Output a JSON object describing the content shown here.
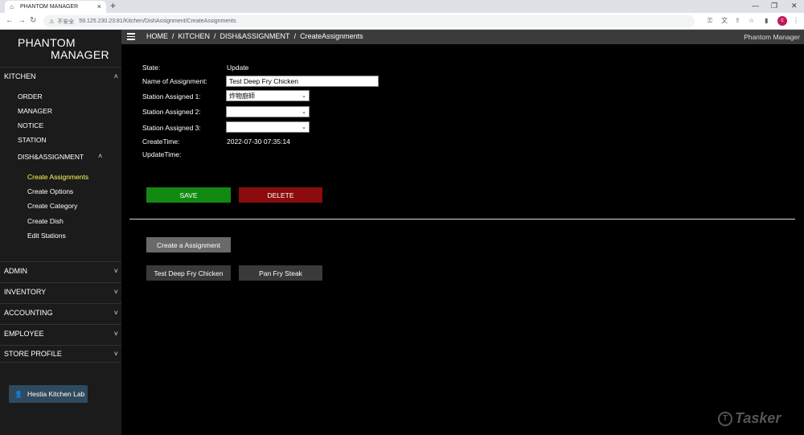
{
  "browser": {
    "tab_title": "PHANTOM MANAGER",
    "insecure_label": "不安全",
    "url": "59.125.230.23:81/Kitchen/DishAssignment/CreateAssignments",
    "profile_initial": "c"
  },
  "sidebar": {
    "brand_line1": "PHANTOM",
    "brand_line2": "MANAGER",
    "kitchen": {
      "label": "KITCHEN",
      "items": [
        "ORDER",
        "MANAGER",
        "NOTICE",
        "STATION"
      ],
      "dish_label": "DISH&ASSIGNMENT",
      "sub_items": [
        "Create Assignments",
        "Create Options",
        "Create Category",
        "Create Dish",
        "Edit Stations"
      ]
    },
    "sections": [
      "ADMIN",
      "INVENTORY",
      "ACCOUNTING",
      "EMPLOYEE",
      "STORE PROFILE"
    ],
    "user_label": "Hestia Kitchen Lab"
  },
  "header": {
    "breadcrumbs": [
      "HOME",
      "KITCHEN",
      "DISH&ASSIGNMENT",
      "CreateAssignments"
    ],
    "separator": "/",
    "app_name": "Phantom Manager"
  },
  "form": {
    "state_label": "State:",
    "state_value": "Update",
    "name_label": "Name of Assignment:",
    "name_value": "Test Deep Fry Chicken",
    "station1_label": "Station Assigned 1:",
    "station1_value": "炸物廚師",
    "station2_label": "Station Assigned 2:",
    "station2_value": "",
    "station3_label": "Station Assigned 3:",
    "station3_value": "",
    "create_time_label": "CreateTime:",
    "create_time_value": "2022-07-30 07:35:14",
    "update_time_label": "UpdateTime:",
    "update_time_value": ""
  },
  "actions": {
    "save_label": "SAVE",
    "delete_label": "DELETE",
    "create_label": "Create a Assignment"
  },
  "assignments": [
    "Test Deep Fry Chicken",
    "Pan Fry Steak"
  ],
  "watermark": "Tasker"
}
